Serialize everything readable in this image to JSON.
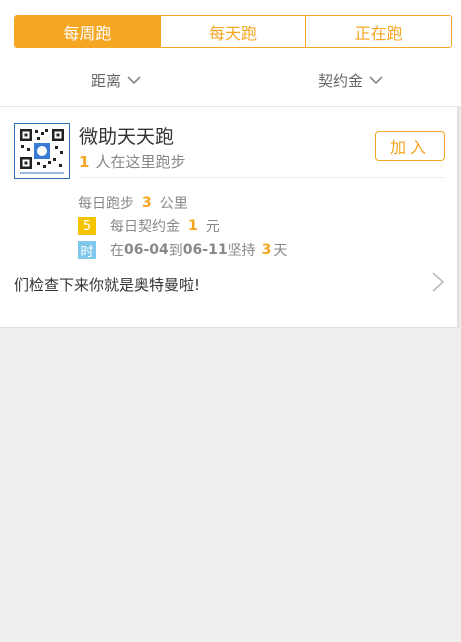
{
  "tabs": [
    {
      "label": "每周跑",
      "active": true
    },
    {
      "label": "每天跑",
      "active": false
    },
    {
      "label": "正在跑",
      "active": false
    }
  ],
  "filters": {
    "distance_label": "距离",
    "deposit_label": "契约金"
  },
  "card": {
    "group_name": "微助天天跑",
    "member_count": "1",
    "member_text": "人在这里跑步",
    "join_label": "加入",
    "daily_run_label": "每日跑步",
    "daily_run_value": "3",
    "daily_run_unit": "公里",
    "deposit_badge": "5",
    "deposit_label": "每日契约金",
    "deposit_value": "1",
    "deposit_unit": "元",
    "time_badge": "时",
    "time_prefix": "在",
    "start_date": "06-04",
    "date_sep": "到",
    "end_date": "06-11",
    "persist_label": "坚持",
    "persist_days": "3",
    "persist_unit": "天",
    "description": "们检查下来你就是奥特曼啦!"
  },
  "colors": {
    "accent": "#f5a623",
    "badge_deposit": "#f5c400",
    "badge_time": "#7fc8ec",
    "qr_border": "#2f6fb3"
  },
  "icons": [
    "chevron-down-icon",
    "chevron-right-icon",
    "qr-code-icon"
  ]
}
